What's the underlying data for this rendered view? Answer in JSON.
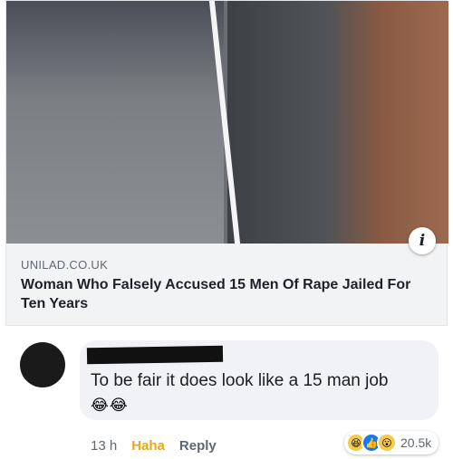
{
  "link_card": {
    "domain": "UNILAD.CO.UK",
    "title": "Woman Who Falsely Accused 15 Men Of Rape Jailed For Ten Years",
    "info_icon": "info-icon"
  },
  "comment": {
    "text": "To be fair it does look like a 15 man job",
    "emojis": "😂😂",
    "time": "13 h",
    "reaction_label": "Haha",
    "reply_label": "Reply",
    "reaction_count": "20.5k",
    "reaction_icons": [
      "haha-icon",
      "like-icon",
      "wow-icon"
    ]
  },
  "colors": {
    "haha": "#e5a81a",
    "like": "#1877f2",
    "bubble": "#f0f2f5"
  }
}
